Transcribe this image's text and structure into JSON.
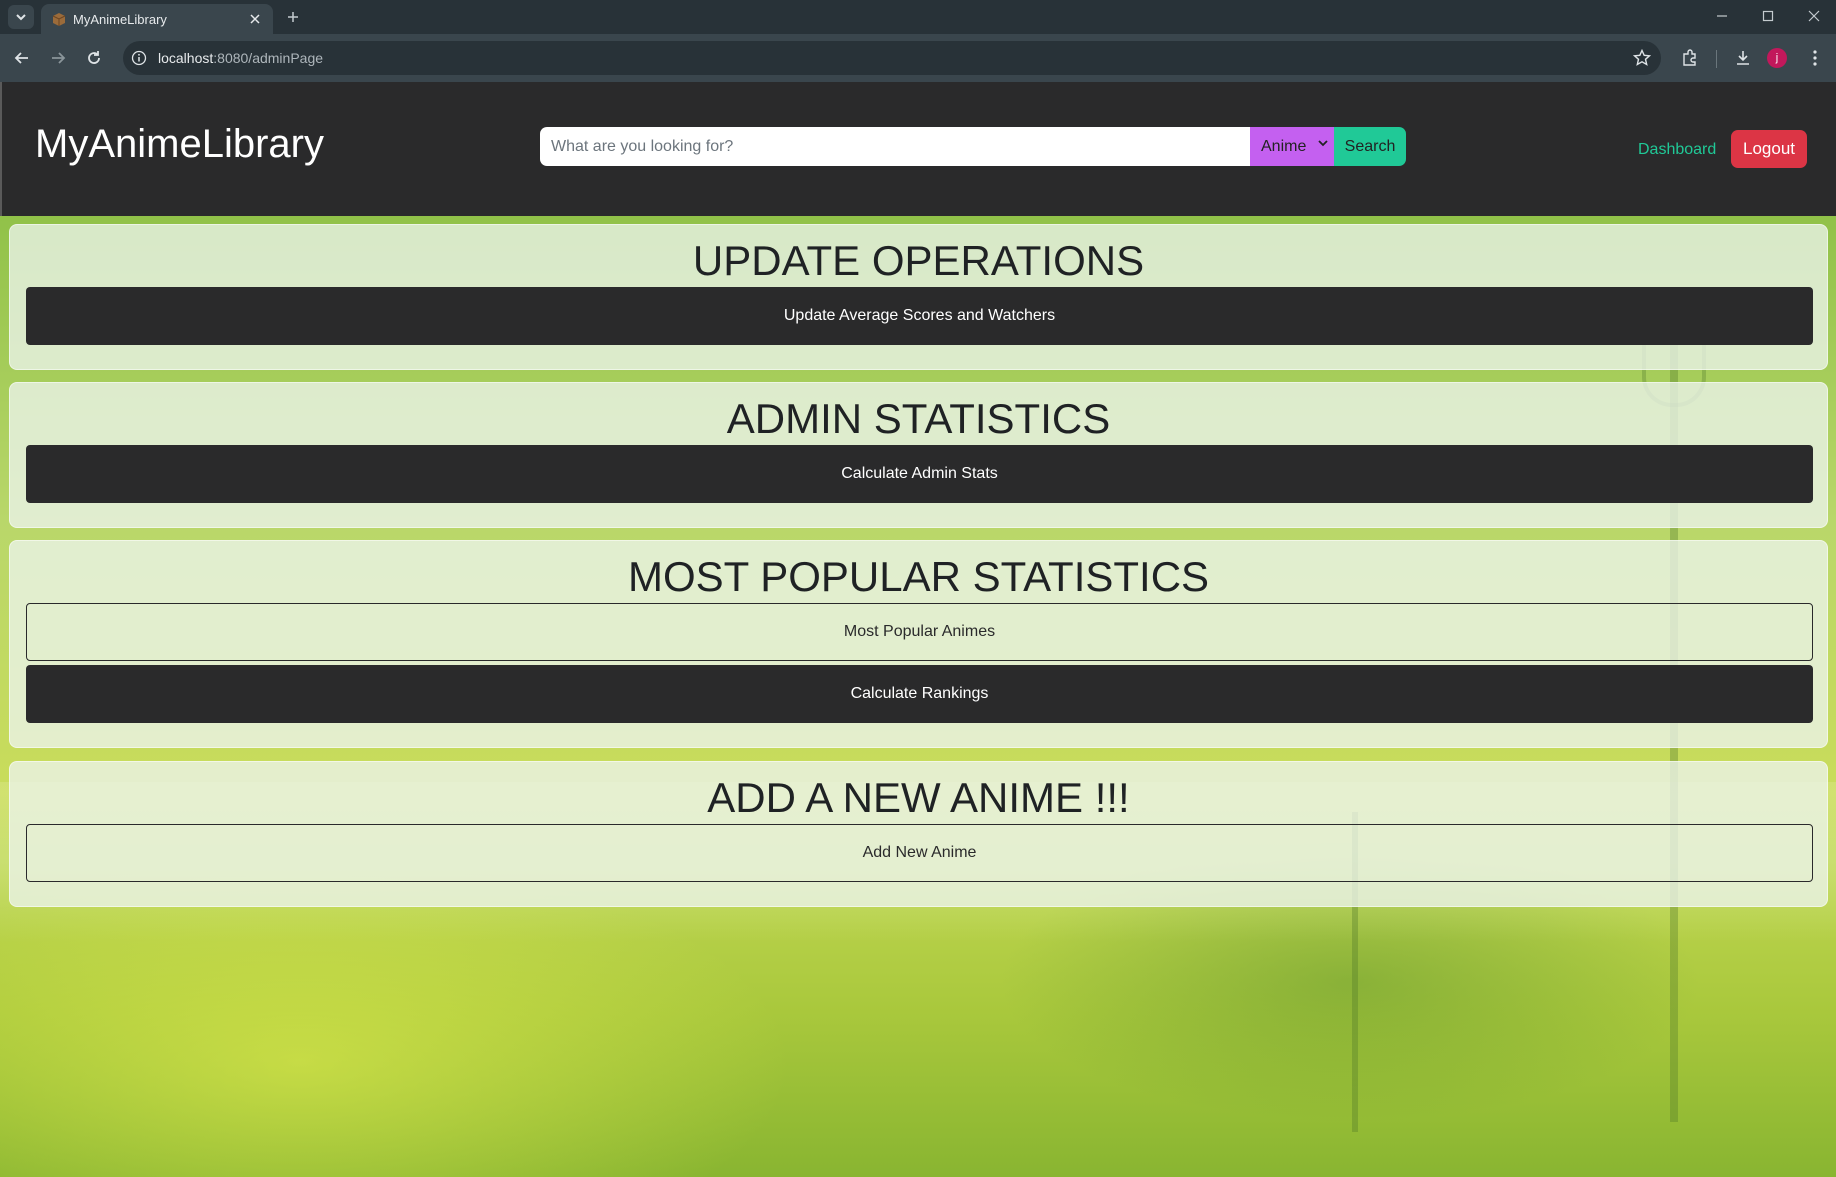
{
  "browser": {
    "tab_title": "MyAnimeLibrary",
    "url_host": "localhost",
    "url_path": ":8080/adminPage",
    "avatar_letter": "j",
    "icons": [
      "tab-menu-icon",
      "favicon-icon",
      "close-icon",
      "plus-icon",
      "minimize-icon",
      "maximize-icon",
      "window-close-icon",
      "back-icon",
      "forward-icon",
      "reload-icon",
      "info-icon",
      "star-icon",
      "extensions-icon",
      "download-icon",
      "kebab-menu-icon"
    ]
  },
  "navbar": {
    "brand": "MyAnimeLibrary",
    "search_placeholder": "What are you looking for?",
    "search_type": "Anime",
    "search_button": "Search",
    "dashboard_link": "Dashboard",
    "logout_button": "Logout"
  },
  "sections": {
    "update": {
      "title": "UPDATE OPERATIONS",
      "button": "Update Average Scores and Watchers"
    },
    "admin": {
      "title": "ADMIN STATISTICS",
      "button": "Calculate Admin Stats"
    },
    "popular": {
      "title": "MOST POPULAR STATISTICS",
      "button_outline": "Most Popular Animes",
      "button_dark": "Calculate Rankings"
    },
    "add": {
      "title": "ADD A NEW ANIME !!!",
      "button": "Add New Anime"
    }
  },
  "colors": {
    "navbar_bg": "#2a2a2b",
    "search_type_bg": "#c460f0",
    "search_btn_bg": "#20c997",
    "dashboard_link": "#20c997",
    "logout_bg": "#dc3545"
  }
}
